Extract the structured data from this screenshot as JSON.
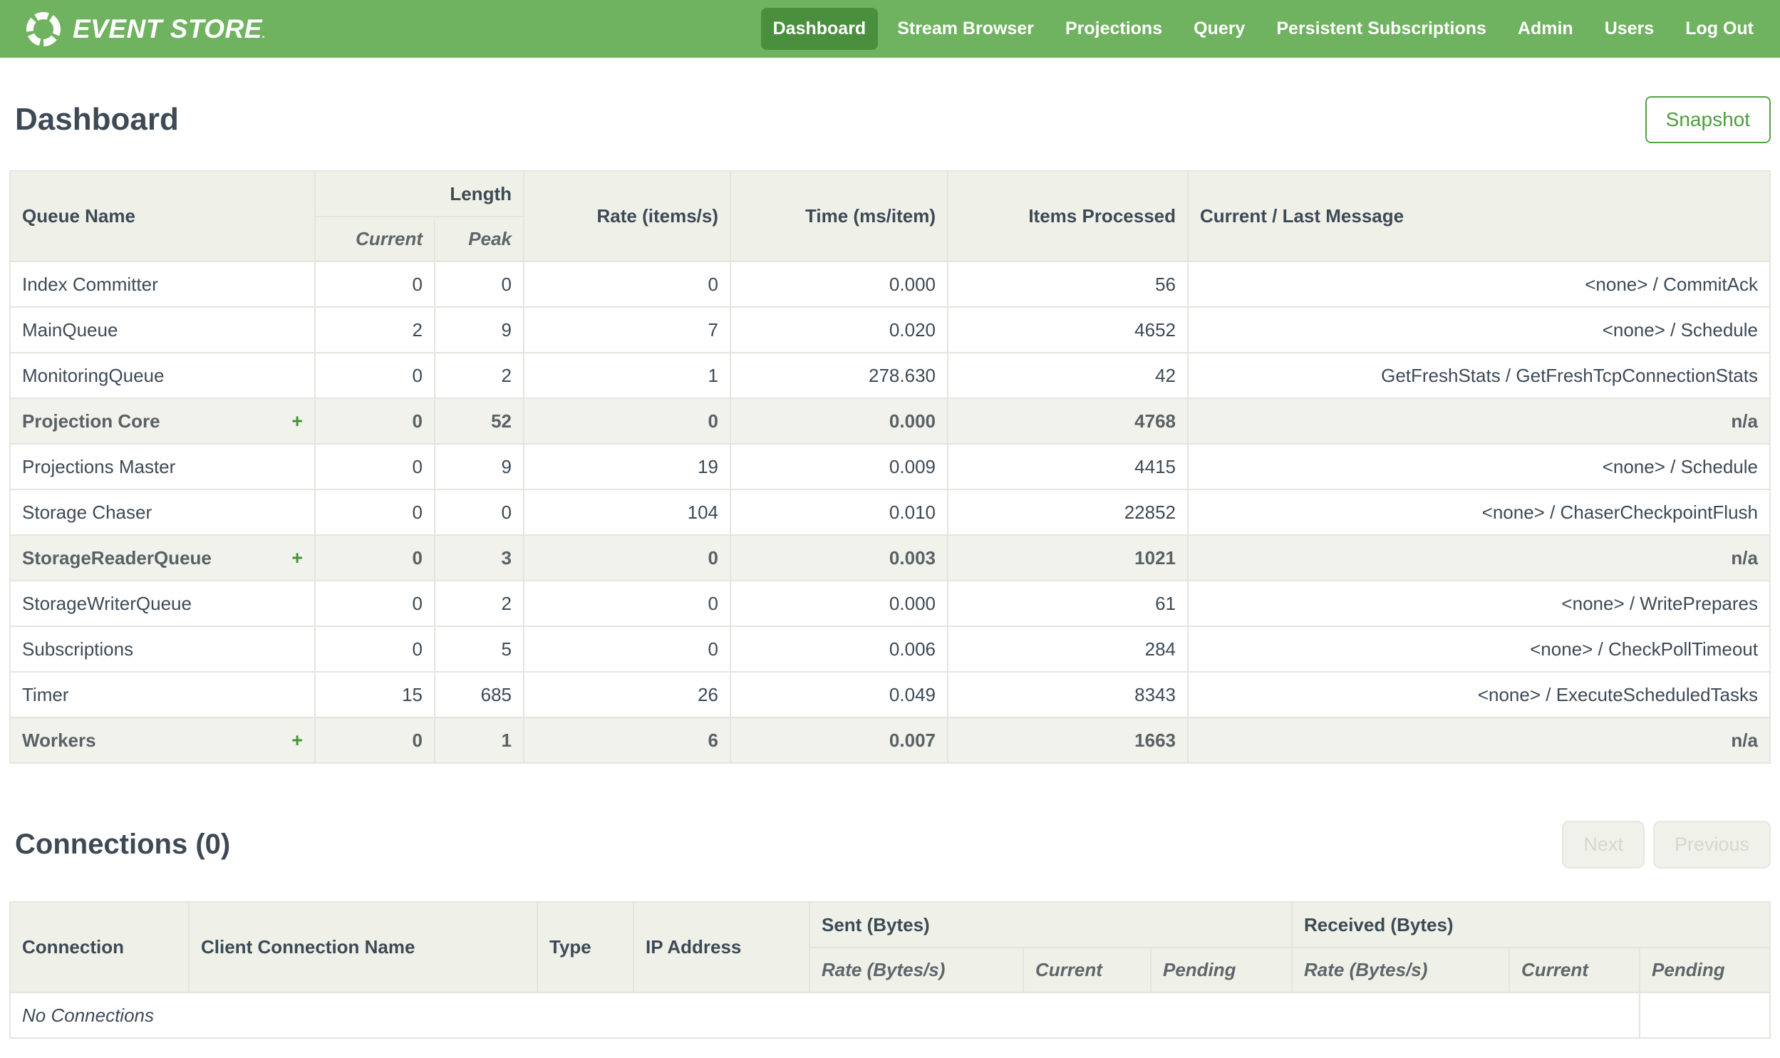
{
  "colors": {
    "nav_green": "#6FB25F",
    "active_tab_green": "#4A8F3E",
    "accent_green": "#4C9E3C",
    "heading_slate": "#3D4A56",
    "table_header_bg": "#EFF1E9"
  },
  "nav": {
    "brand": "EVENT STORE",
    "brand_mark": ".",
    "items": [
      {
        "label": "Dashboard",
        "active": true
      },
      {
        "label": "Stream Browser"
      },
      {
        "label": "Projections"
      },
      {
        "label": "Query"
      },
      {
        "label": "Persistent Subscriptions"
      },
      {
        "label": "Admin"
      },
      {
        "label": "Users"
      },
      {
        "label": "Log Out"
      }
    ]
  },
  "page": {
    "title": "Dashboard"
  },
  "toolbar": {
    "snapshot_label": "Snapshot"
  },
  "queues": {
    "headers": {
      "queue_name": "Queue Name",
      "length": "Length",
      "current": "Current",
      "peak": "Peak",
      "rate": "Rate (items/s)",
      "time": "Time (ms/item)",
      "items_processed": "Items Processed",
      "message": "Current / Last Message"
    },
    "expand_icon": "+",
    "rows": [
      {
        "name": "Index Committer",
        "group": false,
        "current": "0",
        "peak": "0",
        "rate": "0",
        "time": "0.000",
        "items": "56",
        "message": "<none> / CommitAck"
      },
      {
        "name": "MainQueue",
        "group": false,
        "current": "2",
        "peak": "9",
        "rate": "7",
        "time": "0.020",
        "items": "4652",
        "message": "<none> / Schedule"
      },
      {
        "name": "MonitoringQueue",
        "group": false,
        "current": "0",
        "peak": "2",
        "rate": "1",
        "time": "278.630",
        "items": "42",
        "message": "GetFreshStats / GetFreshTcpConnectionStats"
      },
      {
        "name": "Projection Core",
        "group": true,
        "current": "0",
        "peak": "52",
        "rate": "0",
        "time": "0.000",
        "items": "4768",
        "message": "n/a"
      },
      {
        "name": "Projections Master",
        "group": false,
        "current": "0",
        "peak": "9",
        "rate": "19",
        "time": "0.009",
        "items": "4415",
        "message": "<none> / Schedule"
      },
      {
        "name": "Storage Chaser",
        "group": false,
        "current": "0",
        "peak": "0",
        "rate": "104",
        "time": "0.010",
        "items": "22852",
        "message": "<none> / ChaserCheckpointFlush"
      },
      {
        "name": "StorageReaderQueue",
        "group": true,
        "current": "0",
        "peak": "3",
        "rate": "0",
        "time": "0.003",
        "items": "1021",
        "message": "n/a"
      },
      {
        "name": "StorageWriterQueue",
        "group": false,
        "current": "0",
        "peak": "2",
        "rate": "0",
        "time": "0.000",
        "items": "61",
        "message": "<none> / WritePrepares"
      },
      {
        "name": "Subscriptions",
        "group": false,
        "current": "0",
        "peak": "5",
        "rate": "0",
        "time": "0.006",
        "items": "284",
        "message": "<none> / CheckPollTimeout"
      },
      {
        "name": "Timer",
        "group": false,
        "current": "15",
        "peak": "685",
        "rate": "26",
        "time": "0.049",
        "items": "8343",
        "message": "<none> / ExecuteScheduledTasks"
      },
      {
        "name": "Workers",
        "group": true,
        "current": "0",
        "peak": "1",
        "rate": "6",
        "time": "0.007",
        "items": "1663",
        "message": "n/a"
      }
    ]
  },
  "connections": {
    "title": "Connections (0)",
    "next_label": "Next",
    "previous_label": "Previous",
    "headers": {
      "connection": "Connection",
      "client_name": "Client Connection Name",
      "type": "Type",
      "ip": "IP Address",
      "sent": "Sent (Bytes)",
      "received": "Received (Bytes)",
      "rate": "Rate (Bytes/s)",
      "current": "Current",
      "pending": "Pending"
    },
    "empty_message": "No Connections"
  }
}
